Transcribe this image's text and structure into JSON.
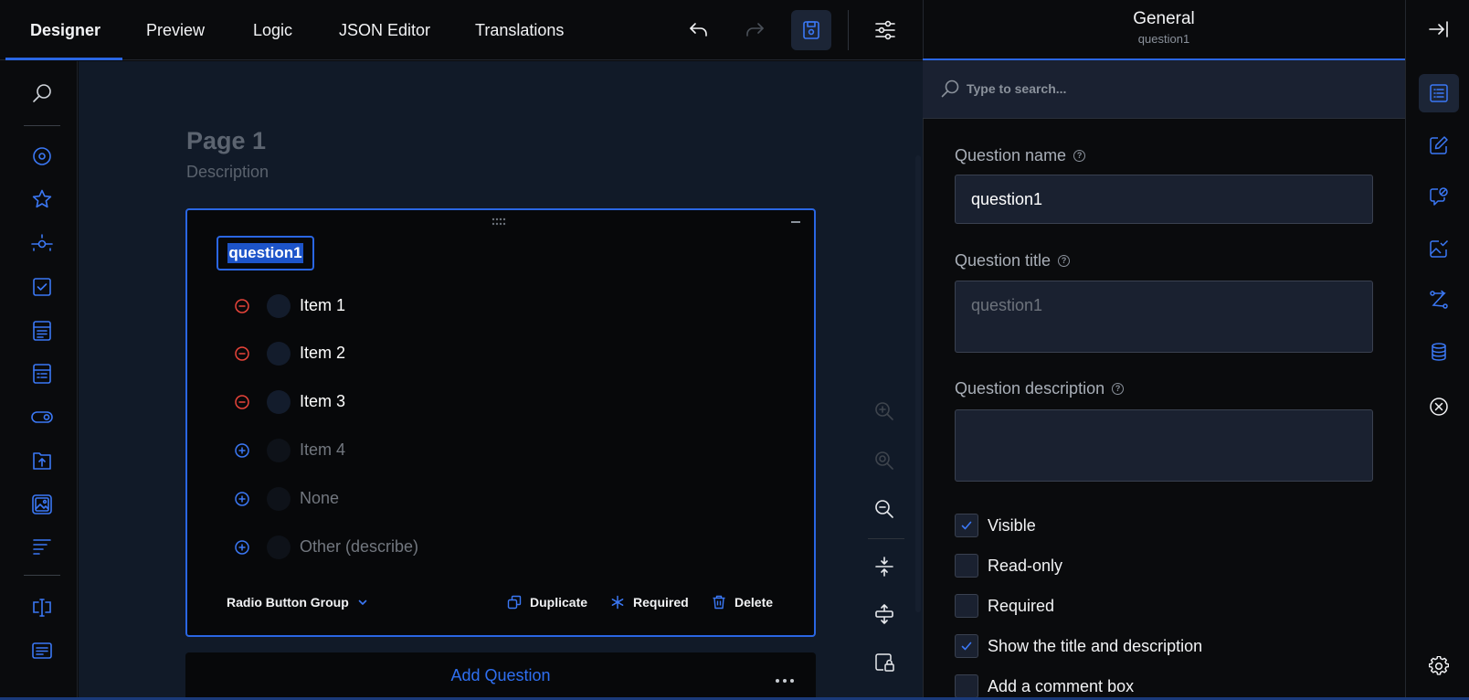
{
  "top_tabs": [
    {
      "label": "Designer",
      "active": true
    },
    {
      "label": "Preview",
      "active": false
    },
    {
      "label": "Logic",
      "active": false
    },
    {
      "label": "JSON Editor",
      "active": false
    },
    {
      "label": "Translations",
      "active": false
    }
  ],
  "toolbar_icons": [
    "undo-icon",
    "redo-icon",
    "save-icon",
    "settings-sliders-icon"
  ],
  "toolbox_icons": [
    "search-icon",
    "radio-group-icon",
    "rating-star-icon",
    "slider-icon",
    "checkbox-icon",
    "dropdown-list-icon",
    "multi-select-list-icon",
    "toggle-boolean-icon",
    "file-upload-icon",
    "image-picker-icon",
    "ranking-icon",
    "single-line-input-icon",
    "comment-long-text-icon"
  ],
  "page": {
    "title": "Page 1",
    "description": "Description"
  },
  "question": {
    "title": "question1",
    "choices": [
      {
        "label": "Item 1",
        "placeholder": false
      },
      {
        "label": "Item 2",
        "placeholder": false
      },
      {
        "label": "Item 3",
        "placeholder": false
      },
      {
        "label": "Item 4",
        "placeholder": true
      },
      {
        "label": "None",
        "placeholder": true
      },
      {
        "label": "Other (describe)",
        "placeholder": true
      }
    ],
    "type_label": "Radio Button Group",
    "actions": {
      "duplicate": "Duplicate",
      "required": "Required",
      "delete": "Delete"
    }
  },
  "add_question": "Add Question",
  "property_grid": {
    "title": "General",
    "subtitle": "question1",
    "search_placeholder": "Type to search...",
    "name_label": "Question name",
    "name_value": "question1",
    "title_label": "Question title",
    "title_placeholder": "question1",
    "description_label": "Question description",
    "checkboxes": [
      {
        "label": "Visible",
        "checked": true
      },
      {
        "label": "Read-only",
        "checked": false
      },
      {
        "label": "Required",
        "checked": false
      },
      {
        "label": "Show the title and description",
        "checked": true
      },
      {
        "label": "Add a comment box",
        "checked": false
      }
    ]
  },
  "colors": {
    "accent": "#2a66e3",
    "remove": "#e8443a",
    "canvas": "#111a28"
  }
}
